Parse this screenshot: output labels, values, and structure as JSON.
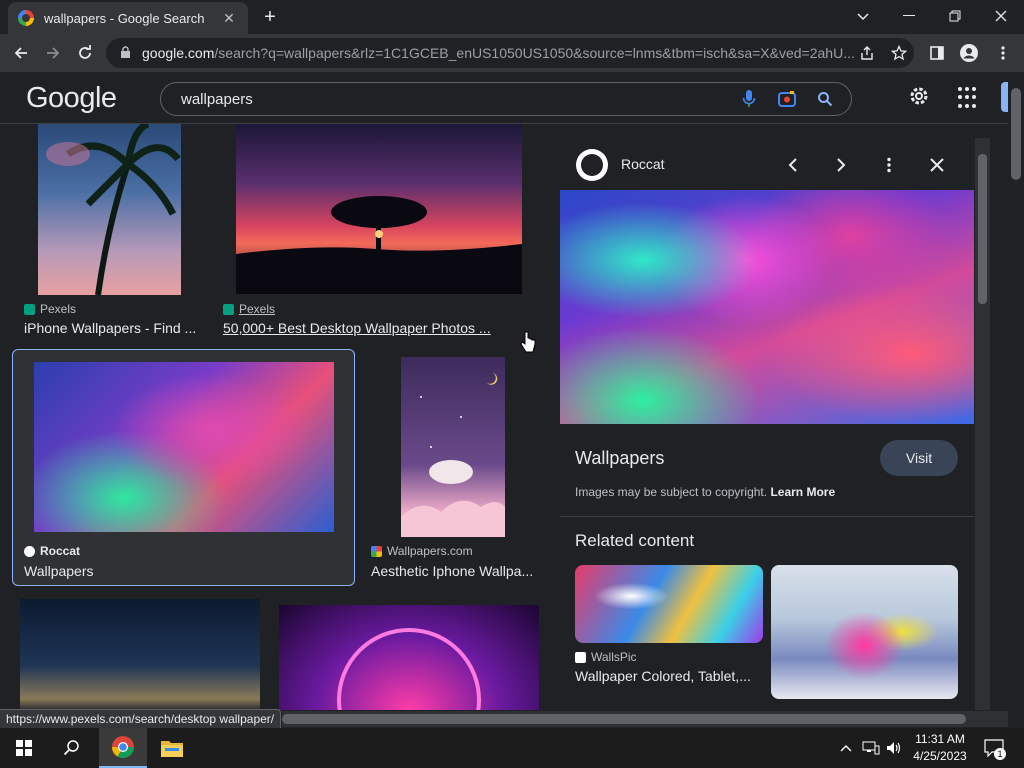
{
  "browser": {
    "tab_title": "wallpapers - Google Search",
    "url_host": "google.com",
    "url_path": "/search?q=wallpapers&rlz=1C1GCEB_enUS1050US1050&source=lnms&tbm=isch&sa=X&ved=2ahU...",
    "status_url": "https://www.pexels.com/search/desktop wallpaper/"
  },
  "google": {
    "logo": "Google",
    "query": "wallpapers"
  },
  "results": [
    {
      "source": "Pexels",
      "caption": "iPhone Wallpapers - Find ..."
    },
    {
      "source": "Pexels",
      "caption": "50,000+ Best Desktop Wallpaper Photos ..."
    },
    {
      "source": "Roccat",
      "caption": "Wallpapers"
    },
    {
      "source": "Wallpapers.com",
      "caption": "Aesthetic Iphone Wallpa..."
    }
  ],
  "panel": {
    "source": "Roccat",
    "title": "Wallpapers",
    "visit_label": "Visit",
    "copyright": "Images may be subject to copyright.",
    "learn_more": "Learn More",
    "related_heading": "Related content",
    "related": [
      {
        "source": "WallsPic",
        "caption": "Wallpaper Colored, Tablet,..."
      }
    ]
  },
  "taskbar": {
    "time": "11:31 AM",
    "date": "4/25/2023",
    "notification_count": "1"
  },
  "colors": {
    "accent": "#8ab4f8",
    "background": "#202124",
    "visit_button": "#394457"
  }
}
